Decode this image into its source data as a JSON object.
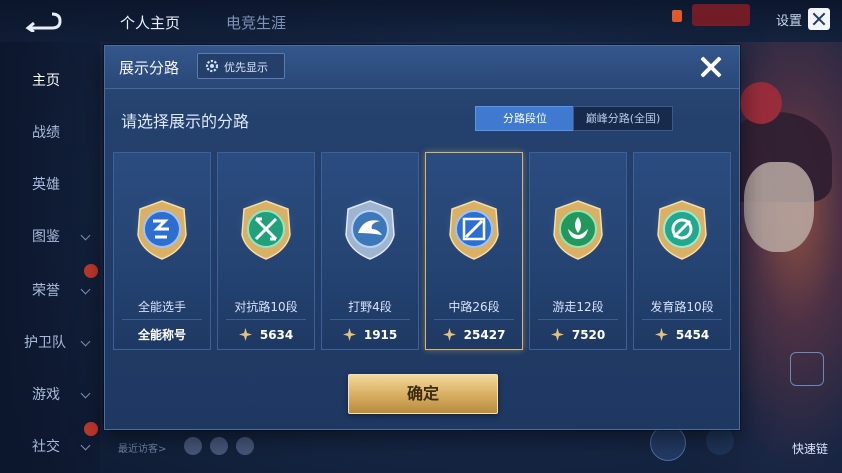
{
  "background": {
    "tabs": [
      "个人主页",
      "电竞生涯"
    ],
    "settings_label": "设置",
    "nav": [
      "主页",
      "战绩",
      "英雄",
      "图鉴",
      "荣誉",
      "护卫队",
      "游戏",
      "社交"
    ],
    "visitor_label": "最近访客>",
    "bottom_right_label": "快速链"
  },
  "modal": {
    "title": "展示分路",
    "priority_label": "优先显示",
    "subtitle": "请选择展示的分路",
    "toggle": {
      "options": [
        "分路段位",
        "巅峰分路(全国)"
      ],
      "selected": "分路段位"
    },
    "confirm_label": "确定",
    "colors": {
      "accent": "#3f7ad0",
      "gold": "#d9b064",
      "panel": "#24406c"
    }
  },
  "cards": [
    {
      "role": "全能选手",
      "title_tag": "全能称号",
      "emblem": "all-round-emblem-icon",
      "color": "#3f7fd8"
    },
    {
      "role": "对抗路10段",
      "score": "5634",
      "emblem": "clash-lane-emblem-icon",
      "color": "#2bb38a"
    },
    {
      "role": "打野4段",
      "score": "1915",
      "emblem": "jungle-emblem-icon",
      "color": "#5c8fc7"
    },
    {
      "role": "中路26段",
      "score": "25427",
      "emblem": "mid-lane-emblem-icon",
      "color": "#3f7fd8",
      "selected": true
    },
    {
      "role": "游走12段",
      "score": "7520",
      "emblem": "roam-emblem-icon",
      "color": "#2fae6f"
    },
    {
      "role": "发育路10段",
      "score": "5454",
      "emblem": "farm-lane-emblem-icon",
      "color": "#2fb59a"
    }
  ]
}
